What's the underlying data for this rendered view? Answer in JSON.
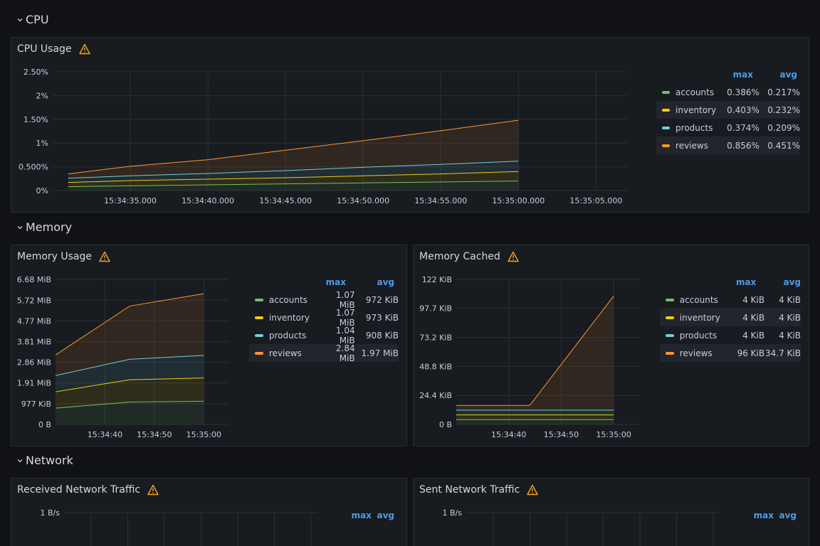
{
  "rows": {
    "cpu": "CPU",
    "memory": "Memory",
    "network": "Network"
  },
  "colors": {
    "accounts": "#73bf69",
    "inventory": "#f2cc0c",
    "products": "#6ed0e0",
    "reviews": "#ff9830",
    "warning": "#f5a623",
    "legend_header": "#4c9be8"
  },
  "panels": {
    "cpu_usage": {
      "title": "CPU Usage",
      "legend": {
        "headers": [
          "max",
          "avg"
        ],
        "rows": [
          {
            "name": "accounts",
            "max": "0.386%",
            "avg": "0.217%"
          },
          {
            "name": "inventory",
            "max": "0.403%",
            "avg": "0.232%"
          },
          {
            "name": "products",
            "max": "0.374%",
            "avg": "0.209%"
          },
          {
            "name": "reviews",
            "max": "0.856%",
            "avg": "0.451%"
          }
        ]
      }
    },
    "memory_usage": {
      "title": "Memory Usage",
      "legend": {
        "headers": [
          "max",
          "avg"
        ],
        "rows": [
          {
            "name": "accounts",
            "max": "1.07 MiB",
            "avg": "972 KiB"
          },
          {
            "name": "inventory",
            "max": "1.07 MiB",
            "avg": "973 KiB"
          },
          {
            "name": "products",
            "max": "1.04 MiB",
            "avg": "908 KiB"
          },
          {
            "name": "reviews",
            "max": "2.84 MiB",
            "avg": "1.97 MiB"
          }
        ]
      }
    },
    "memory_cached": {
      "title": "Memory Cached",
      "legend": {
        "headers": [
          "max",
          "avg"
        ],
        "rows": [
          {
            "name": "accounts",
            "max": "4 KiB",
            "avg": "4 KiB"
          },
          {
            "name": "inventory",
            "max": "4 KiB",
            "avg": "4 KiB"
          },
          {
            "name": "products",
            "max": "4 KiB",
            "avg": "4 KiB"
          },
          {
            "name": "reviews",
            "max": "96 KiB",
            "avg": "34.7 KiB"
          }
        ]
      }
    },
    "received_network": {
      "title": "Received Network Traffic",
      "legend": {
        "headers": [
          "max",
          "avg"
        ]
      }
    },
    "sent_network": {
      "title": "Sent Network Traffic",
      "legend": {
        "headers": [
          "max",
          "avg"
        ]
      }
    }
  },
  "chart_data": [
    {
      "id": "cpu",
      "type": "area",
      "title": "CPU Usage",
      "y_unit": "%",
      "ylim": [
        0,
        2.5
      ],
      "ytick_values": [
        0,
        0.5,
        1,
        1.5,
        2,
        2.5
      ],
      "ytick_labels": [
        "0%",
        "0.500%",
        "1%",
        "1.50%",
        "2%",
        "2.50%"
      ],
      "xlim": [
        0,
        37
      ],
      "xtick_values": [
        5,
        10,
        15,
        20,
        25,
        30,
        35
      ],
      "xtick_labels": [
        "15:34:35.000",
        "15:34:40.000",
        "15:34:45.000",
        "15:34:50.000",
        "15:34:55.000",
        "15:35:00.000",
        "15:35:05.000"
      ],
      "stacked": true,
      "x": [
        1,
        5,
        10,
        15,
        20,
        25,
        30
      ],
      "series": [
        {
          "name": "accounts",
          "values": [
            0.08,
            0.1,
            0.12,
            0.14,
            0.16,
            0.18,
            0.2
          ]
        },
        {
          "name": "inventory",
          "values": [
            0.09,
            0.11,
            0.12,
            0.13,
            0.15,
            0.17,
            0.2
          ]
        },
        {
          "name": "products",
          "values": [
            0.09,
            0.1,
            0.12,
            0.15,
            0.18,
            0.2,
            0.22
          ]
        },
        {
          "name": "reviews",
          "values": [
            0.09,
            0.2,
            0.29,
            0.43,
            0.56,
            0.71,
            0.86
          ]
        }
      ]
    },
    {
      "id": "mem",
      "type": "area",
      "title": "Memory Usage",
      "ylim": [
        0,
        6.68
      ],
      "ytick_values": [
        0,
        0.954,
        1.91,
        2.86,
        3.81,
        4.77,
        5.72,
        6.68
      ],
      "ytick_labels": [
        "0 B",
        "977 KiB",
        "1.91 MiB",
        "2.86 MiB",
        "3.81 MiB",
        "4.77 MiB",
        "5.72 MiB",
        "6.68 MiB"
      ],
      "xlim": [
        0,
        35
      ],
      "xtick_values": [
        10,
        20,
        30
      ],
      "xtick_labels": [
        "15:34:40",
        "15:34:50",
        "15:35:00"
      ],
      "stacked": true,
      "x": [
        0,
        15,
        30
      ],
      "series": [
        {
          "name": "accounts",
          "values": [
            0.75,
            1.03,
            1.07
          ]
        },
        {
          "name": "inventory",
          "values": [
            0.75,
            1.03,
            1.07
          ]
        },
        {
          "name": "products",
          "values": [
            0.75,
            0.94,
            1.04
          ]
        },
        {
          "name": "reviews",
          "values": [
            0.95,
            2.45,
            2.84
          ]
        }
      ]
    },
    {
      "id": "cache",
      "type": "area",
      "title": "Memory Cached",
      "ylim": [
        0,
        122
      ],
      "ytick_values": [
        0,
        24.4,
        48.8,
        73.2,
        97.7,
        122
      ],
      "ytick_labels": [
        "0 B",
        "24.4 KiB",
        "48.8 KiB",
        "73.2 KiB",
        "97.7 KiB",
        "122 KiB"
      ],
      "xlim": [
        0,
        35
      ],
      "xtick_values": [
        10,
        20,
        30
      ],
      "xtick_labels": [
        "15:34:40",
        "15:34:50",
        "15:35:00"
      ],
      "stacked": true,
      "x": [
        0,
        14,
        30
      ],
      "series": [
        {
          "name": "accounts",
          "values": [
            4,
            4,
            4
          ]
        },
        {
          "name": "inventory",
          "values": [
            4,
            4,
            4
          ]
        },
        {
          "name": "products",
          "values": [
            4,
            4,
            4
          ]
        },
        {
          "name": "reviews",
          "values": [
            4,
            4,
            96
          ]
        }
      ]
    },
    {
      "id": "rx",
      "type": "line",
      "title": "Received Network Traffic",
      "ytick_labels": [
        "1 B/s"
      ]
    },
    {
      "id": "tx",
      "type": "line",
      "title": "Sent Network Traffic",
      "ytick_labels": [
        "1 B/s"
      ]
    }
  ]
}
